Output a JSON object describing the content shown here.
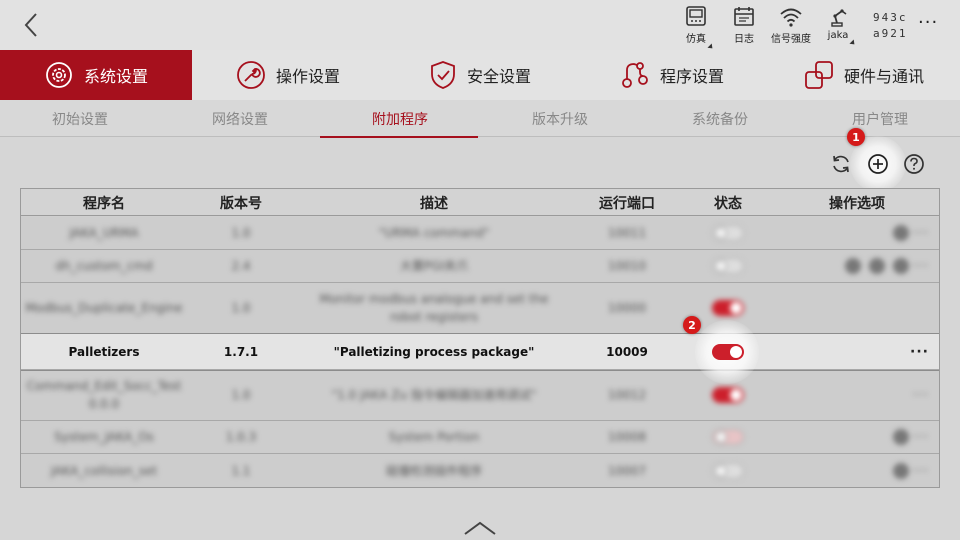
{
  "topbar": {
    "status_items": [
      {
        "label": "仿真",
        "icon": "monitor-icon"
      },
      {
        "label": "日志",
        "icon": "log-icon"
      },
      {
        "label": "信号强度",
        "icon": "wifi-icon"
      },
      {
        "label": "jaka",
        "icon": "robot-arm-icon"
      }
    ],
    "serial_line1": "943c",
    "serial_line2": "a921",
    "more": "···"
  },
  "main_nav": [
    {
      "label": "系统设置",
      "icon": "system-settings-icon",
      "active": true
    },
    {
      "label": "操作设置",
      "icon": "wrench-icon",
      "active": false
    },
    {
      "label": "安全设置",
      "icon": "shield-icon",
      "active": false
    },
    {
      "label": "程序设置",
      "icon": "program-icon",
      "active": false
    },
    {
      "label": "硬件与通讯",
      "icon": "hardware-icon",
      "active": false
    }
  ],
  "sub_nav": [
    {
      "label": "初始设置",
      "active": false
    },
    {
      "label": "网络设置",
      "active": false
    },
    {
      "label": "附加程序",
      "active": true
    },
    {
      "label": "版本升级",
      "active": false
    },
    {
      "label": "系统备份",
      "active": false
    },
    {
      "label": "用户管理",
      "active": false
    }
  ],
  "toolbar": {
    "refresh_icon": "refresh-icon",
    "add_icon": "add-circle-icon",
    "help_icon": "help-icon",
    "marker_add": "1",
    "marker_toggle": "2"
  },
  "table": {
    "headers": [
      "程序名",
      "版本号",
      "描述",
      "运行端口",
      "状态",
      "操作选项"
    ],
    "rows": [
      {
        "name": "JAKA_URMA",
        "version": "1.0",
        "desc": "\"URMA command\"",
        "port": "10011",
        "enabled": false,
        "blurred": true
      },
      {
        "name": "dh_custom_cmd",
        "version": "2.4",
        "desc": "大寰PGI夹爪",
        "port": "10010",
        "enabled": false,
        "blurred": true
      },
      {
        "name": "Modbus_Duplicate_Engine",
        "version": "1.0",
        "desc": "Monitor modbus analogue and set the robot registers",
        "port": "10000",
        "enabled": true,
        "blurred": true
      },
      {
        "name": "Palletizers",
        "version": "1.7.1",
        "desc": "\"Palletizing process package\"",
        "port": "10009",
        "enabled": true,
        "blurred": false
      },
      {
        "name": "Command_Edit_Socc_Test 0.0.0",
        "version": "1.0",
        "desc": "\"1.0 JAKA Zu 指令编辑器加速用调试\"",
        "port": "10012",
        "enabled": true,
        "blurred": true
      },
      {
        "name": "System_JAKA_Os",
        "version": "1.0.3",
        "desc": "System Portion",
        "port": "10008",
        "enabled": false,
        "blurred": true
      },
      {
        "name": "JAKA_collision_set",
        "version": "1.1",
        "desc": "碰撞检测插件程序",
        "port": "10007",
        "enabled": false,
        "blurred": true
      }
    ],
    "focus_more": "···"
  },
  "colors": {
    "accent": "#a6101d",
    "toggle_on": "#cc1f2b",
    "marker": "#d51a1a"
  }
}
